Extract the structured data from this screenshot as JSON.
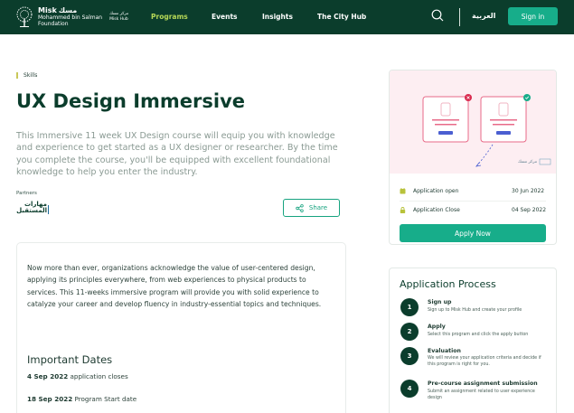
{
  "header": {
    "logo": {
      "name": "Misk",
      "arabic": "مسك",
      "sub1": "Mohammed bin Salman",
      "sub2": "Foundation",
      "hub_ar": "مركز مسك",
      "hub_en": "Misk Hub"
    },
    "nav": [
      {
        "label": "Programs",
        "active": true
      },
      {
        "label": "Events",
        "active": false
      },
      {
        "label": "Insights",
        "active": false
      },
      {
        "label": "The City Hub",
        "active": false
      }
    ],
    "language": "العربية",
    "signin_label": "Sign in"
  },
  "program": {
    "category": "Skills",
    "title": "UX Design Immersive",
    "description": "This Immersive 11 week UX Design course will equip you with knowledge and experience to get started as a UX designer or researcher. By the time you complete the course, you'll be equipped with excellent foundational knowledge to help you enter the industry.",
    "partners_label": "Partners",
    "partner_logo_line1": "مهارات",
    "partner_logo_line2": "المستقبل",
    "share_label": "Share",
    "body": "Now more than ever, organizations acknowledge the value of user-centered design, applying its principles everywhere, from web experiences to physical products to services. This 11-weeks immersive program will provide you with solid experience to catalyze your career and develop fluency in industry-essential topics and techniques.",
    "important_dates_title": "Important Dates",
    "dates": [
      {
        "date": "4 Sep 2022",
        "label": "application closes"
      },
      {
        "date": "18 Sep 2022",
        "label": "Program Start date"
      }
    ]
  },
  "application": {
    "open_label": "Application open",
    "open_date": "30 Jun 2022",
    "close_label": "Application Close",
    "close_date": "04 Sep 2022",
    "apply_label": "Apply Now",
    "illustration_brand": "مركز مسك"
  },
  "process": {
    "title": "Application Process",
    "steps": [
      {
        "num": "1",
        "title": "Sign up",
        "desc": "Sign up to Misk Hub and create your profile"
      },
      {
        "num": "2",
        "title": "Apply",
        "desc": "Select this program and click the apply button"
      },
      {
        "num": "3",
        "title": "Evaluation",
        "desc": "We will review your application criteria and decide if this program is right for you."
      },
      {
        "num": "4",
        "title": "Pre-course assignment submission",
        "desc": "Submit an assignment related to user experience design"
      }
    ]
  },
  "colors": {
    "primary": "#0b3d2c",
    "accent": "#17ad8a",
    "nav_active": "#b6d857",
    "illustration_bg": "#fdeef2"
  }
}
